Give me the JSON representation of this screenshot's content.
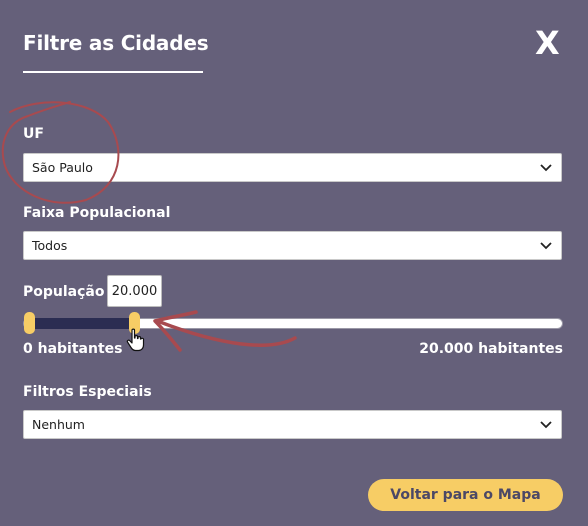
{
  "header": {
    "title": "Filtre as Cidades",
    "close_label": "X"
  },
  "uf": {
    "label": "UF",
    "value": "São Paulo"
  },
  "faixa": {
    "label": "Faixa Populacional",
    "value": "Todos"
  },
  "populacao": {
    "label": "População",
    "input_value": "20.000",
    "min_label": "0 habitantes",
    "max_label": "20.000 habitantes",
    "fill_fraction": 0.2
  },
  "filtros": {
    "label": "Filtros Especiais",
    "value": "Nenhum"
  },
  "footer": {
    "back_label": "Voltar para o Mapa"
  },
  "colors": {
    "background": "#65607a",
    "accent": "#f7cd65",
    "slider_fill": "#2b2d52",
    "annotation": "#a84a4f"
  },
  "icons": [
    "chevron-down-icon",
    "pointer-hand-icon"
  ]
}
